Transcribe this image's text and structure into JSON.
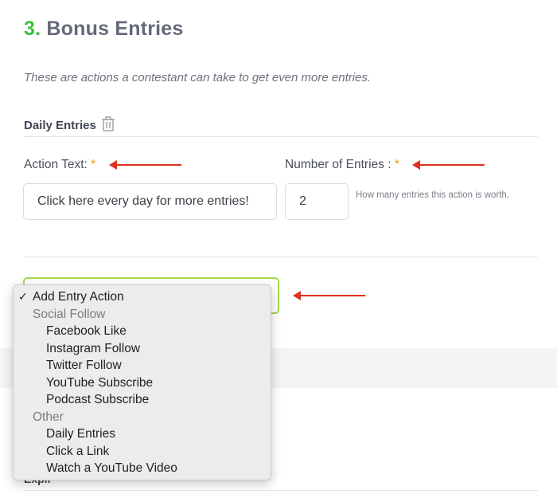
{
  "section": {
    "number": "3.",
    "title": "Bonus Entries",
    "description": "These are actions a contestant can take to get even more entries."
  },
  "entry_block": {
    "label": "Daily Entries",
    "icon": "trash-icon",
    "action_text": {
      "label": "Action Text:",
      "required_marker": "*",
      "value": "Click here every day for more entries!"
    },
    "number_of_entries": {
      "label": "Number of Entries :",
      "required_marker": "*",
      "value": "2",
      "help_text": "How many entries this action is worth."
    }
  },
  "add_entry_select": {
    "selected": "Add Entry Action",
    "check_mark": "✓",
    "caret": "up-down-caret-icon",
    "options": [
      {
        "type": "selected",
        "label": "Add Entry Action"
      },
      {
        "type": "group",
        "label": "Social Follow"
      },
      {
        "type": "child",
        "label": "Facebook Like"
      },
      {
        "type": "child",
        "label": "Instagram Follow"
      },
      {
        "type": "child",
        "label": "Twitter Follow"
      },
      {
        "type": "child",
        "label": "YouTube Subscribe"
      },
      {
        "type": "child",
        "label": "Podcast Subscribe"
      },
      {
        "type": "group",
        "label": "Other"
      },
      {
        "type": "child",
        "label": "Daily Entries"
      },
      {
        "type": "child",
        "label": "Click a Link"
      },
      {
        "type": "child",
        "label": "Watch a YouTube Video"
      }
    ]
  },
  "partial_text": "Expir",
  "colors": {
    "accent_green": "#3cbf3c",
    "select_border": "#a6d94a",
    "required": "#f39c12",
    "annotation_arrow": "#e0301e"
  }
}
